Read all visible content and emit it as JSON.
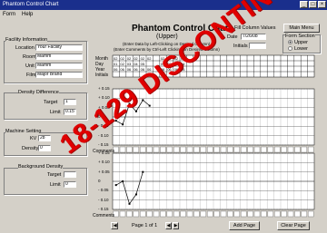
{
  "window": {
    "title": "Phantom Control Chart"
  },
  "menu": [
    "Form",
    "Help"
  ],
  "chart": {
    "title": "Phantom Control Chart",
    "subtitle": "(Upper)",
    "instruction1": "(Enter Data by Left-Clicking on Desired Column)",
    "instruction2": "(Enter Comments by Ctrl-Left Clicking on Desired Column)"
  },
  "fill": {
    "label": "Fill Column Values",
    "date_label": "Date",
    "date": "7/26/08",
    "initials_label": "Initials",
    "initials": ""
  },
  "main_menu": "Main Menu",
  "form_section": {
    "label": "Form Section",
    "options": [
      "Upper",
      "Lower"
    ],
    "selected": 0
  },
  "facility": {
    "header": "Facility Information",
    "location_label": "Location",
    "location": "Your Facility",
    "room_label": "Room",
    "room": "Mamm",
    "unit_label": "Unit",
    "unit": "Mamm",
    "film_label": "Film",
    "film": "Major Brand"
  },
  "table_rows": [
    {
      "label": "Month",
      "cells": [
        "02",
        "02",
        "02",
        "02",
        "02",
        "02",
        "",
        "02",
        "02",
        "02",
        "02"
      ]
    },
    {
      "label": "Day",
      "cells": [
        "01",
        "02",
        "03",
        "04",
        "05",
        "",
        "",
        "01",
        "02",
        "03",
        "04"
      ]
    },
    {
      "label": "Year",
      "cells": [
        "06",
        "06",
        "06",
        "06",
        "06",
        "06",
        "",
        "06",
        "06",
        "06",
        "06"
      ]
    },
    {
      "label": "Initials",
      "cells": [
        "",
        "",
        "",
        "",
        "",
        "",
        "",
        "",
        "",
        "",
        ""
      ]
    }
  ],
  "density_diff": {
    "header": "Density Difference",
    "target_label": "Target",
    "target": "1",
    "limit_label": "Limit",
    "limit": "0.15"
  },
  "machine": {
    "header": "Machine Setting",
    "kv_label": "KV",
    "kv": "28",
    "density_label": "Density",
    "density": "0"
  },
  "bg_density": {
    "header": "Background Density",
    "target_label": "Target",
    "target": "",
    "limit_label": "Limit",
    "limit": "0"
  },
  "upper_axis": [
    "+ 0.15",
    "+ 0.10",
    "+ 0.05",
    "0",
    "- 0.05",
    "- 0.10",
    "- 0.15"
  ],
  "lower_axis": [
    "+ 0.15",
    "+ 0.10",
    "+ 0.05",
    "0",
    "- 0.05",
    "- 0.10",
    "- 0.15"
  ],
  "comments_label": "Comments",
  "pagination": {
    "text": "Page 1 of 1"
  },
  "add_page": "Add Page",
  "clear_page": "Clear Page",
  "watermark": "18-129 DISCONTINUED",
  "upper_series": [
    -0.02,
    -0.04,
    0.07,
    0.03,
    0.09,
    0.06
  ],
  "lower_series": [
    -0.02,
    0.0,
    -0.12,
    -0.07,
    0.05
  ]
}
